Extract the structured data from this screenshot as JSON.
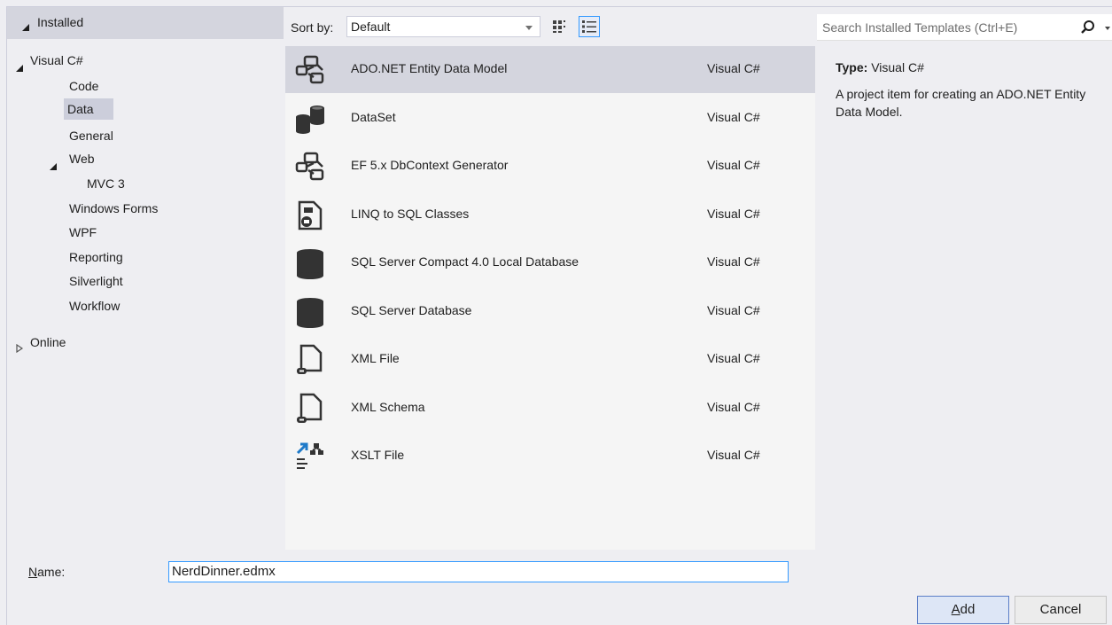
{
  "tree": {
    "installed_label": "Installed",
    "visual_csharp": "Visual C#",
    "children": [
      "Code",
      "Data",
      "General"
    ],
    "web": "Web",
    "web_children": [
      "MVC 3"
    ],
    "more_children": [
      "Windows Forms",
      "WPF",
      "Reporting",
      "Silverlight",
      "Workflow"
    ],
    "online": "Online"
  },
  "sort": {
    "label": "Sort by:",
    "value": "Default"
  },
  "items": [
    {
      "name": "ADO.NET Entity Data Model",
      "type": "Visual C#",
      "icon": "entity-model-icon"
    },
    {
      "name": "DataSet",
      "type": "Visual C#",
      "icon": "dataset-icon"
    },
    {
      "name": "EF 5.x DbContext Generator",
      "type": "Visual C#",
      "icon": "dbcontext-generator-icon"
    },
    {
      "name": "LINQ to SQL Classes",
      "type": "Visual C#",
      "icon": "linq-to-sql-icon"
    },
    {
      "name": "SQL Server Compact 4.0 Local Database",
      "type": "Visual C#",
      "icon": "database-icon"
    },
    {
      "name": "SQL Server Database",
      "type": "Visual C#",
      "icon": "database-icon"
    },
    {
      "name": "XML File",
      "type": "Visual C#",
      "icon": "xml-file-icon"
    },
    {
      "name": "XML Schema",
      "type": "Visual C#",
      "icon": "xml-schema-icon"
    },
    {
      "name": "XSLT File",
      "type": "Visual C#",
      "icon": "xslt-file-icon"
    }
  ],
  "search": {
    "placeholder": "Search Installed Templates (Ctrl+E)"
  },
  "details": {
    "type_label": "Type:",
    "type_value": "Visual C#",
    "description": "A project item for creating an ADO.NET Entity Data Model."
  },
  "name_field": {
    "label_first": "N",
    "label_rest": "ame:",
    "value": "NerdDinner.edmx"
  },
  "buttons": {
    "add_first": "A",
    "add_rest": "dd",
    "cancel": "Cancel"
  },
  "colors": {
    "selection": "#d4d5de",
    "accent": "#3399ff"
  }
}
